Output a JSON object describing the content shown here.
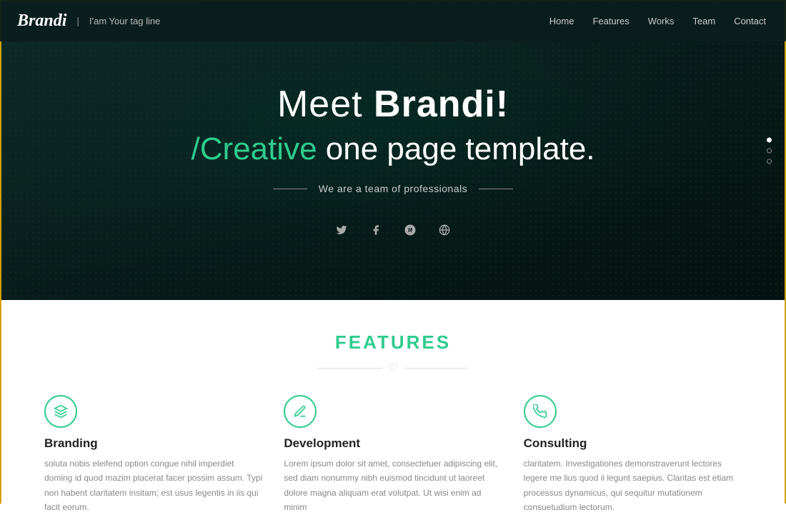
{
  "navbar": {
    "logo": "Brandi",
    "divider": "|",
    "tagline": "I'am Your tag line",
    "nav_items": [
      {
        "label": "Home",
        "href": "#"
      },
      {
        "label": "Features",
        "href": "#"
      },
      {
        "label": "Works",
        "href": "#"
      },
      {
        "label": "Team",
        "href": "#"
      },
      {
        "label": "Contact",
        "href": "#"
      }
    ]
  },
  "hero": {
    "title_plain": "Meet ",
    "title_bold": "Brandi!",
    "subtitle_accent": "/Creative",
    "subtitle_plain": " one page template.",
    "tagline": "We are a team of professionals",
    "dots": [
      {
        "active": true
      },
      {
        "active": false
      },
      {
        "active": false
      }
    ],
    "socials": [
      {
        "icon": "𝕋",
        "label": "twitter",
        "unicode": "𝕋"
      },
      {
        "icon": "f",
        "label": "facebook"
      },
      {
        "icon": "g+",
        "label": "google-plus"
      },
      {
        "icon": "⊕",
        "label": "web"
      }
    ]
  },
  "features": {
    "section_title": "FEATURES",
    "items": [
      {
        "icon": "🎨",
        "name": "Branding",
        "description": "soluta nobis eleifend option congue nihil imperdiet doming id quod mazim placerat facer possim assum. Typi non habent claritatem insitam; est usus legentis in iis qui facit eorum."
      },
      {
        "icon": "✏",
        "name": "Development",
        "description": "Lorem ipsum dolor sit amet, consectetuer adipiscing elit, sed diam nonummy nibh euismod tincidunt ut laoreet dolore magna aliquam erat volutpat. Ut wisi enim ad minim"
      },
      {
        "icon": "📢",
        "name": "Consulting",
        "description": "claritatem. Investigationes demonstraverunt lectores legere me lius quod ii legunt saepius. Claritas est etiam processus dynamicus, qui sequitur mutationem consuetudium lectorum."
      }
    ]
  }
}
